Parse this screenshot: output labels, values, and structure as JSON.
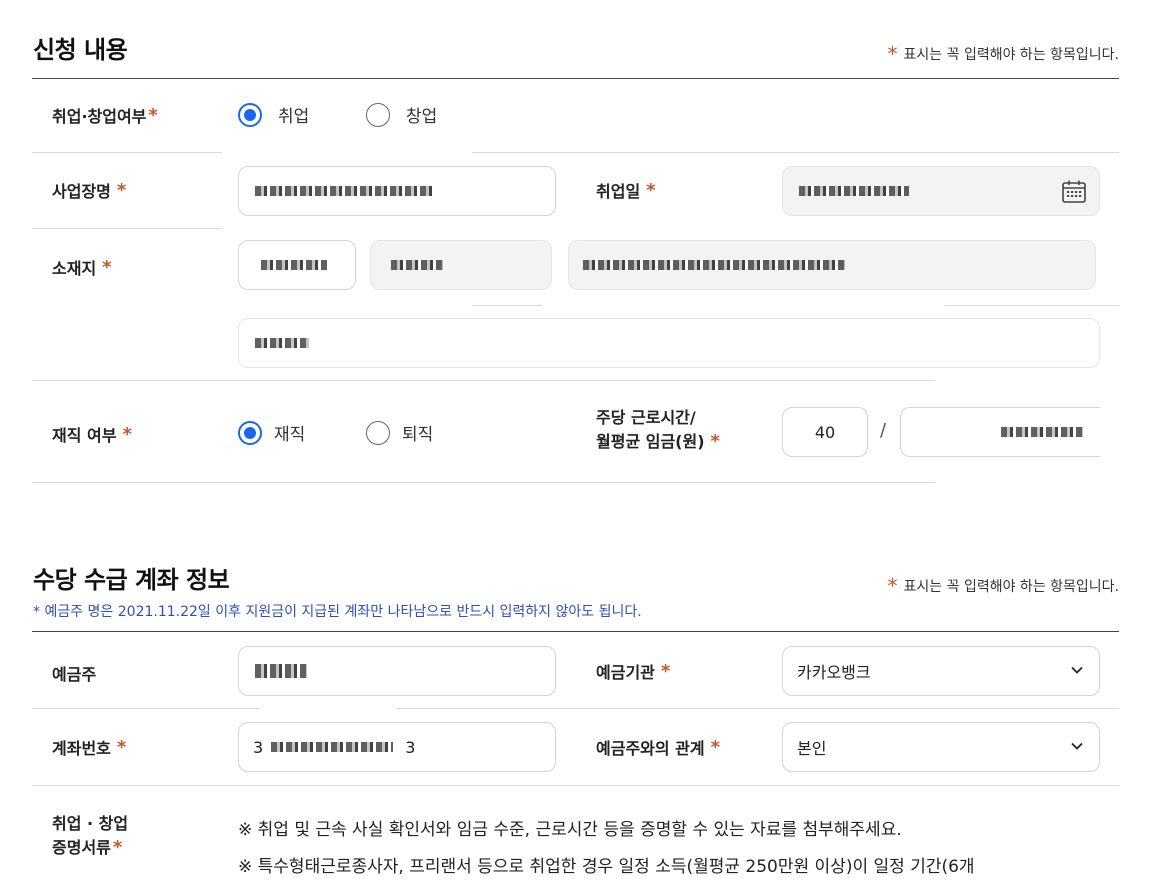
{
  "section1": {
    "title": "신청 내용",
    "required_note": "표시는 꼭 입력해야 하는 항목입니다.",
    "employment_type": {
      "label": "취업·창업여부",
      "options": [
        "취업",
        "창업"
      ],
      "selected": "취업"
    },
    "workplace": {
      "label": "사업장명",
      "value": ""
    },
    "employment_date": {
      "label": "취업일",
      "value": ""
    },
    "location": {
      "label": "소재지"
    },
    "employment_status": {
      "label": "재직 여부",
      "options": [
        "재직",
        "퇴직"
      ],
      "selected": "재직"
    },
    "hours_wage": {
      "label_line1": "주당 근로시간/",
      "label_line2": "월평균 임금(원)",
      "hours": "40",
      "separator": "/"
    }
  },
  "section2": {
    "title": "수당 수급 계좌 정보",
    "required_note": "표시는 꼭 입력해야 하는 항목입니다.",
    "notice": "* 예금주 명은 2021.11.22일 이후 지원금이 지급된 계좌만 나타남으로 반드시 입력하지 않아도 됩니다.",
    "account_holder": {
      "label": "예금주"
    },
    "bank": {
      "label": "예금기관",
      "value": "카카오뱅크"
    },
    "account_number": {
      "label": "계좌번호",
      "value_prefix": "3",
      "value_suffix": "3"
    },
    "relation": {
      "label": "예금주와의 관계",
      "value": "본인"
    },
    "proof_docs": {
      "label_line1": "취업 · 창업",
      "label_line2": "증명서류",
      "lines": [
        "※ 취업 및 근속 사실 확인서와 임금 수준, 근로시간 등을 증명할 수 있는 자료를 첨부해주세요.",
        "※ 특수형태근로종사자, 프리랜서 등으로 취업한 경우 일정 소득(월평균 250만원 이상)이 일정 기간(6개"
      ]
    }
  },
  "colors": {
    "accent": "#1a66f0",
    "required_star": "#c8552a",
    "notice": "#2f50b8"
  },
  "icons": {
    "calendar": "calendar-icon",
    "chevron": "chevron-down-icon"
  }
}
